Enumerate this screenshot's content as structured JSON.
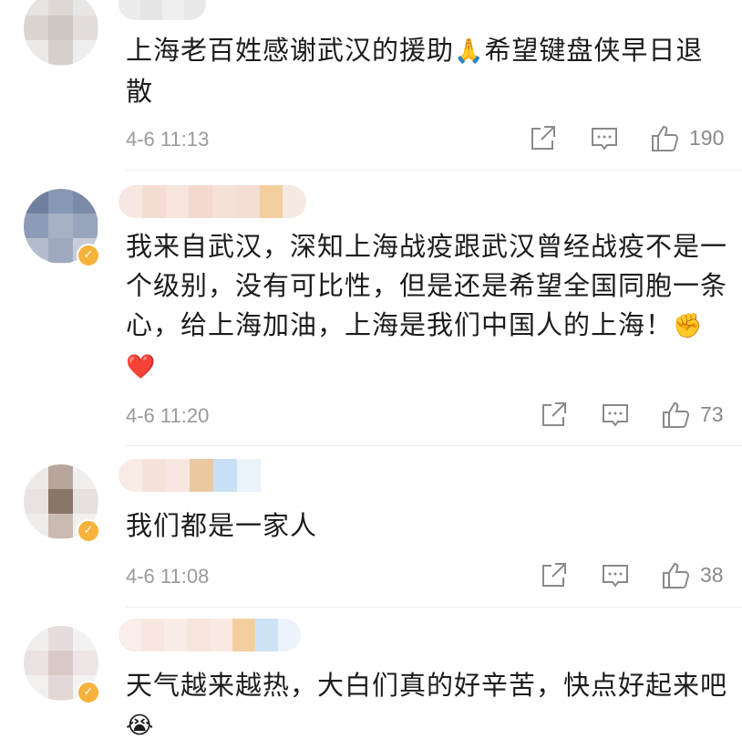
{
  "comments": [
    {
      "text": "上海老百姓感谢武汉的援助",
      "emoji": "🙏",
      "text2": "希望键盘侠早日退散",
      "time": "4-6 11:13",
      "likes": "190"
    },
    {
      "text": "我来自武汉，深知上海战疫跟武汉曾经战疫不是一个级别，没有可比性，但是还是希望全国同胞一条心，给上海加油，上海是我们中国人的上海！",
      "emoji1": "✊",
      "emoji2": "❤️",
      "time": "4-6 11:20",
      "likes": "73"
    },
    {
      "text": "我们都是一家人",
      "time": "4-6 11:08",
      "likes": "38"
    },
    {
      "text": "天气越来越热，大白们真的好辛苦，快点好起来吧",
      "emoji": "😭"
    }
  ],
  "icons": {
    "share": "share-icon",
    "reply": "comment-icon",
    "like": "thumbs-up-icon",
    "verified": "verified-badge-icon"
  },
  "colors": {
    "badge": "#f6b23b",
    "meta": "#9a9a9a",
    "divider": "#ececec"
  }
}
